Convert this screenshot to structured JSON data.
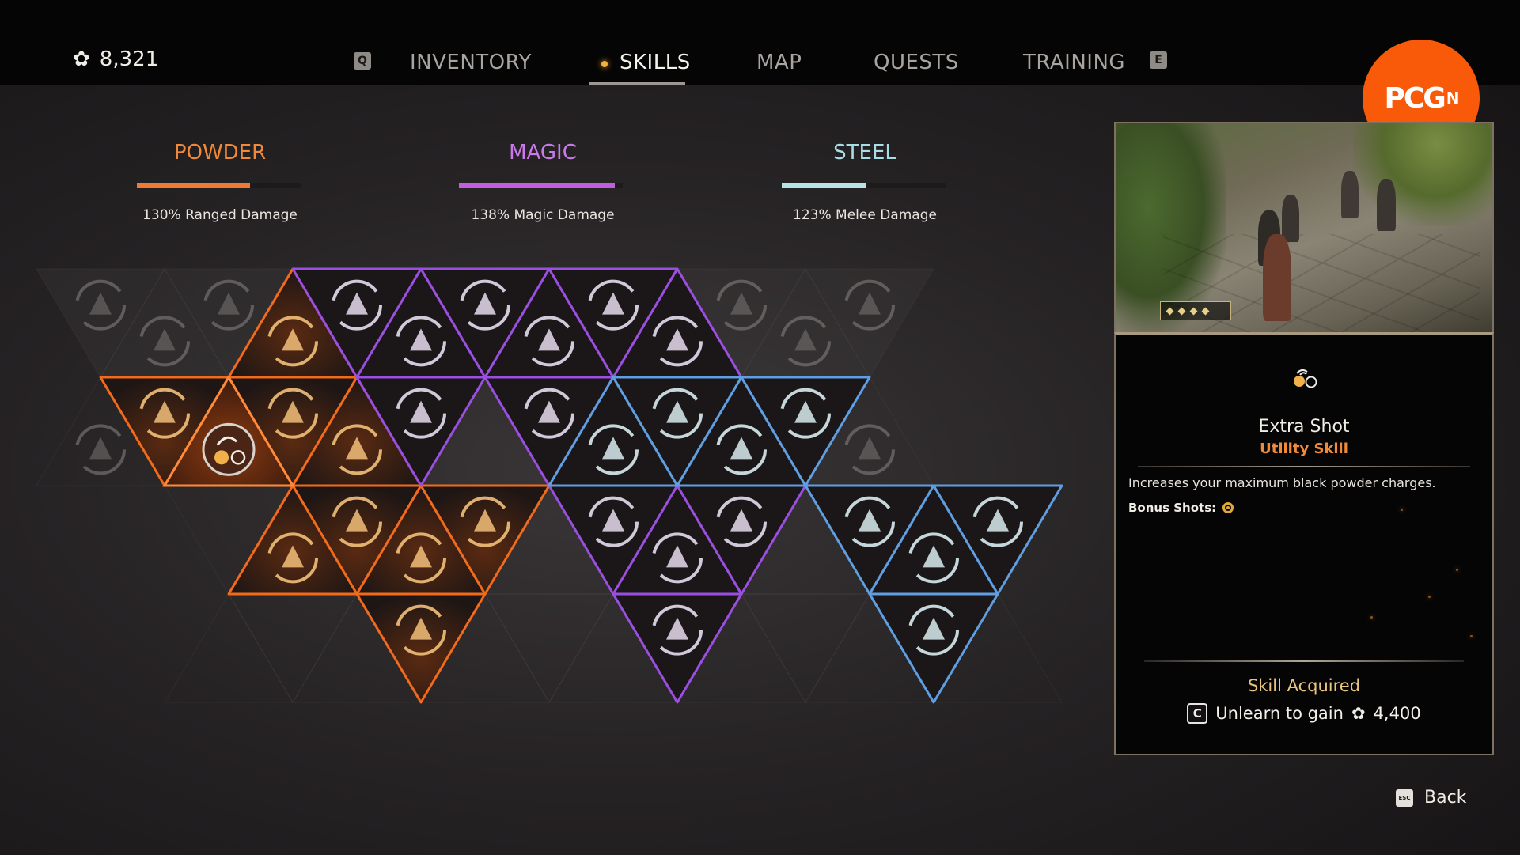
{
  "currency": {
    "icon": "gear-coin-icon",
    "amount": "8,321"
  },
  "nav": {
    "prev_key": "Q",
    "next_key": "E",
    "tabs": [
      {
        "label": "INVENTORY",
        "active": false
      },
      {
        "label": "SKILLS",
        "active": true
      },
      {
        "label": "MAP",
        "active": false
      },
      {
        "label": "QUESTS",
        "active": false
      },
      {
        "label": "TRAINING",
        "active": false
      }
    ]
  },
  "logo": {
    "text": "PCG",
    "superscript": "N",
    "color": "#f95a0a"
  },
  "trees": [
    {
      "name": "POWDER",
      "color": "#f08a3a",
      "progress": 0.69,
      "stat": "130% Ranged Damage"
    },
    {
      "name": "MAGIC",
      "color": "#c77ae8",
      "progress": 0.95,
      "stat": "138% Magic Damage"
    },
    {
      "name": "STEEL",
      "color": "#a8dde6",
      "progress": 0.51,
      "stat": "123% Melee Damage"
    }
  ],
  "board": {
    "powder_color": "#f26a1b",
    "magic_color": "#9a4fe0",
    "steel_color": "#5f9ee0",
    "selected": "extra-shot"
  },
  "selected_skill": {
    "name": "Extra Shot",
    "type": "Utility Skill",
    "description": "Increases your maximum black powder charges.",
    "bonus_label": "Bonus Shots:",
    "status": "Skill Acquired",
    "unlearn_key": "C",
    "unlearn_label": "Unlearn to gain",
    "refund": "4,400"
  },
  "footer": {
    "back_key": "ESC",
    "back_label": "Back"
  }
}
